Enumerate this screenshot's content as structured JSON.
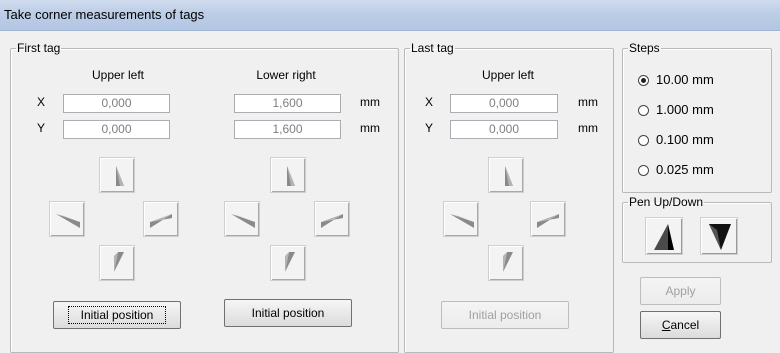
{
  "window": {
    "title": "Take corner measurements of tags"
  },
  "first_tag": {
    "legend": "First tag",
    "upper_left": {
      "heading": "Upper left",
      "x": "0,000",
      "y": "0,000"
    },
    "lower_right": {
      "heading": "Lower right",
      "x": "1,600",
      "y": "1,600"
    },
    "unit": "mm",
    "x_label": "X",
    "y_label": "Y",
    "initial_position_upper_left": "Initial position",
    "initial_position_lower_right": "Initial position"
  },
  "last_tag": {
    "legend": "Last tag",
    "upper_left": {
      "heading": "Upper left",
      "x": "0,000",
      "y": "0,000"
    },
    "unit": "mm",
    "x_label": "X",
    "y_label": "Y",
    "initial_position": "Initial position"
  },
  "steps": {
    "legend": "Steps",
    "options": [
      "10.00 mm",
      "1.000 mm",
      "0.100 mm",
      "0.025 mm"
    ],
    "selected": "10.00 mm"
  },
  "pen": {
    "legend": "Pen Up/Down",
    "up_icon": "pen-up-icon",
    "down_icon": "pen-down-icon"
  },
  "actions": {
    "apply": "Apply",
    "cancel_prefix": "C",
    "cancel_rest": "ancel"
  },
  "icons": {
    "up": "arrow-up-icon",
    "down": "arrow-down-icon",
    "left": "arrow-left-icon",
    "right": "arrow-right-icon"
  }
}
